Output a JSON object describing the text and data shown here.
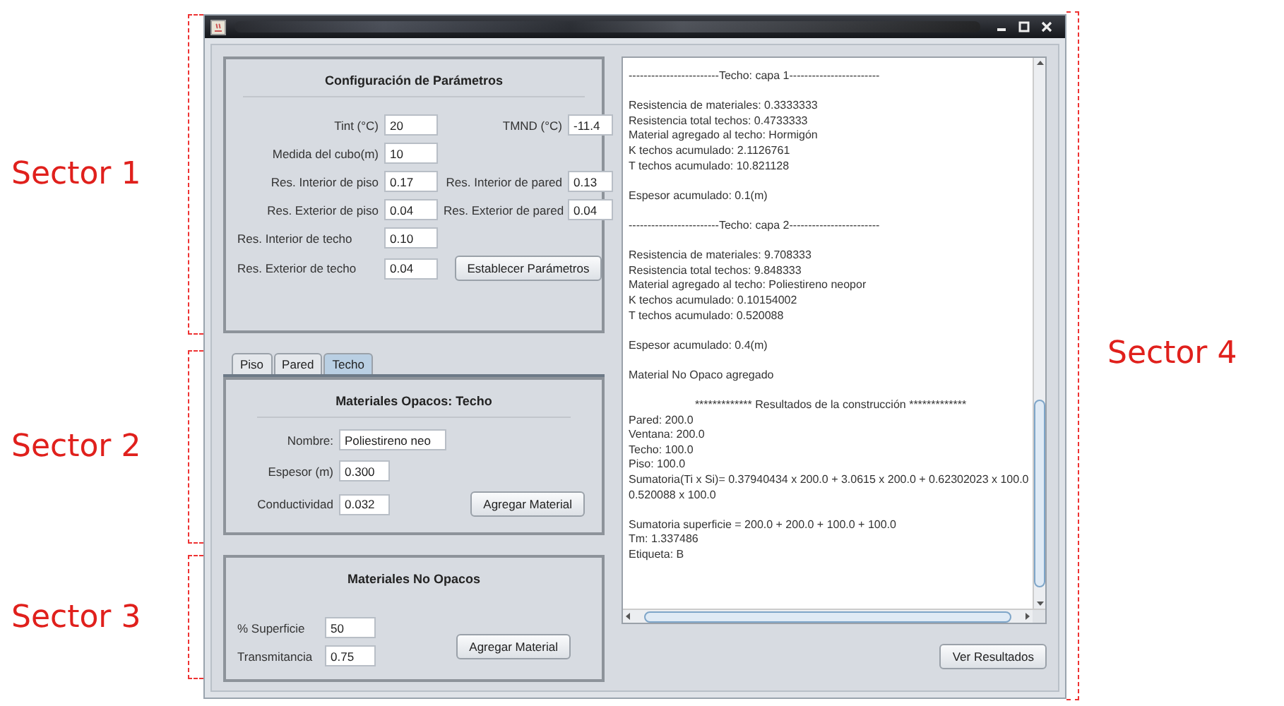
{
  "annotations": {
    "sectors": [
      "Sector 1",
      "Sector 2",
      "Sector 3"
    ],
    "right_sector": "Sector 4"
  },
  "config": {
    "title": "Configuración de Parámetros",
    "rows": [
      {
        "fields": [
          {
            "label": "Tint (°C)",
            "value": "20"
          },
          {
            "label": "TMND (°C)",
            "value": "-11.4"
          }
        ]
      },
      {
        "fields": [
          {
            "label": "Medida del cubo(m)",
            "value": "10"
          }
        ]
      },
      {
        "fields": [
          {
            "label": "Res. Interior de piso",
            "value": "0.17"
          },
          {
            "label": "Res. Interior de pared",
            "value": "0.13"
          }
        ]
      },
      {
        "fields": [
          {
            "label": "Res. Exterior de piso",
            "value": "0.04"
          },
          {
            "label": "Res. Exterior de pared",
            "value": "0.04"
          }
        ]
      },
      {
        "fields": [
          {
            "label": "Res. Interior de techo",
            "value": "0.10"
          }
        ]
      },
      {
        "fields": [
          {
            "label": "Res. Exterior de techo",
            "value": "0.04"
          }
        ],
        "button": "Establecer Parámetros"
      }
    ]
  },
  "tabs": [
    {
      "label": "Piso",
      "selected": false
    },
    {
      "label": "Pared",
      "selected": false
    },
    {
      "label": "Techo",
      "selected": true
    }
  ],
  "opaque": {
    "title": "Materiales Opacos: Techo",
    "fields": [
      {
        "label": "Nombre:",
        "value": "Poliestireno neo"
      },
      {
        "label": "Espesor (m)",
        "value": "0.300"
      },
      {
        "label": "Conductividad",
        "value": "0.032"
      }
    ],
    "button": "Agregar Material"
  },
  "non_opaque": {
    "title": "Materiales No Opacos",
    "fields": [
      {
        "label": "% Superficie",
        "value": "50"
      },
      {
        "label": "Transmitancia",
        "value": "0.75"
      }
    ],
    "button": "Agregar Material"
  },
  "output": {
    "paragraphs": [
      {
        "lines": [
          "------------------------Techo: capa 1------------------------"
        ]
      },
      {
        "lines": [
          "Resistencia de materiales: 0.3333333",
          "Resistencia total techos: 0.4733333",
          "Material agregado al techo: Hormigón",
          "K techos acumulado: 2.1126761",
          "T techos acumulado: 10.821128"
        ]
      },
      {
        "lines": [
          "Espesor acumulado: 0.1(m)"
        ]
      },
      {
        "lines": [
          "------------------------Techo: capa 2------------------------"
        ]
      },
      {
        "lines": [
          "Resistencia de materiales: 9.708333",
          "Resistencia total techos: 9.848333",
          "Material agregado al techo: Poliestireno neopor",
          "K techos acumulado: 0.10154002",
          "T techos acumulado: 0.520088"
        ]
      },
      {
        "lines": [
          "Espesor acumulado: 0.4(m)"
        ]
      },
      {
        "lines": [
          "Material No Opaco agregado"
        ],
        "spaced": true
      },
      {
        "heading": "************* Resultados de la construcción *************",
        "lines": [
          "Pared: 200.0",
          "Ventana: 200.0",
          "Techo: 100.0",
          "Piso: 100.0",
          "Sumatoria(Ti x Si)= 0.37940434 x 200.0 + 3.0615 x 200.0 + 0.62302023 x 100.0",
          "0.520088 x 100.0"
        ]
      },
      {
        "lines": [
          "Sumatoria superficie = 200.0 + 200.0 + 100.0 + 100.0",
          "Tm: 1.337486",
          "Etiqueta: B"
        ]
      }
    ]
  },
  "results_button": "Ver Resultados"
}
